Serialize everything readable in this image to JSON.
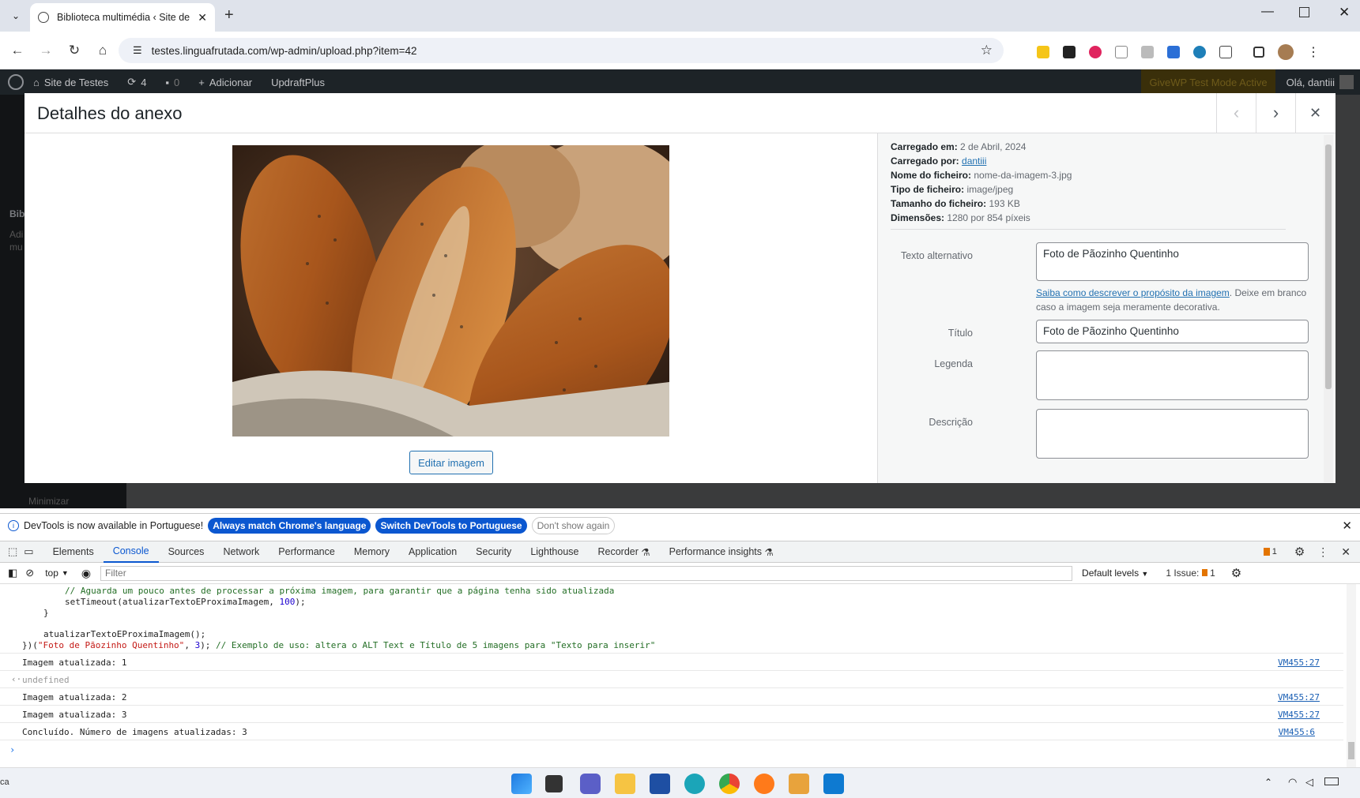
{
  "browser": {
    "tab_title": "Biblioteca multimédia ‹ Site de",
    "url": "testes.linguafrutada.com/wp-admin/upload.php?item=42"
  },
  "wpbar": {
    "site_name": "Site de Testes",
    "updates": "4",
    "comments": "0",
    "add_new": "Adicionar",
    "plugin": "UpdraftPlus",
    "givewp": "GiveWP Test Mode Active",
    "greeting": "Olá, dantiii"
  },
  "sidebar_partial": {
    "title": "Bibl",
    "sub1": "Adi",
    "sub2": "mu",
    "minimize": "Minimizar"
  },
  "modal": {
    "title": "Detalhes do anexo",
    "edit_image": "Editar imagem",
    "info": {
      "uploaded_on_label": "Carregado em:",
      "uploaded_on": "2 de Abril, 2024",
      "uploaded_by_label": "Carregado por:",
      "uploaded_by": "dantiii",
      "filename_label": "Nome do ficheiro:",
      "filename": "nome-da-imagem-3.jpg",
      "filetype_label": "Tipo de ficheiro:",
      "filetype": "image/jpeg",
      "filesize_label": "Tamanho do ficheiro:",
      "filesize": "193 KB",
      "dimensions_label": "Dimensões:",
      "dimensions": "1280 por 854 píxeis"
    },
    "alt_label": "Texto alternativo",
    "alt_value": "Foto de Pãozinho Quentinho",
    "alt_help_link": "Saiba como descrever o propósito da imagem",
    "alt_help_text": ". Deixe em branco caso a imagem seja meramente decorativa.",
    "title_label": "Título",
    "title_value": "Foto de Pãozinho Quentinho",
    "caption_label": "Legenda",
    "description_label": "Descrição"
  },
  "devtools": {
    "info_text": "DevTools is now available in Portuguese!",
    "btn_match": "Always match Chrome's language",
    "btn_switch": "Switch DevTools to Portuguese",
    "btn_dont": "Don't show again",
    "tabs": [
      "Elements",
      "Console",
      "Sources",
      "Network",
      "Performance",
      "Memory",
      "Application",
      "Security",
      "Lighthouse",
      "Recorder",
      "Performance insights"
    ],
    "issues_count": "1",
    "context": "top",
    "filter_placeholder": "Filter",
    "levels": "Default levels",
    "issues_label": "1 Issue:",
    "issues_num": "1",
    "code": {
      "l1": "// Aguarda um pouco antes de processar a próxima imagem, para garantir que a página tenha sido atualizada",
      "l2a": "setTimeout(atualizarTextoEProximaImagem, ",
      "l2n": "100",
      "l2b": ");",
      "l3": "}",
      "l4": "atualizarTextoEProximaImagem();",
      "l5a": "})(",
      "l5s": "\"Foto de Pãozinho Quentinho\"",
      "l5b": ", ",
      "l5n": "3",
      "l5c": "); ",
      "l5cm": "// Exemplo de uso: altera o ALT Text e Título de 5 imagens para \"Texto para inserir\""
    },
    "log": [
      {
        "msg": "Imagem atualizada: 1",
        "src": "VM455:27"
      },
      {
        "msg": "undefined",
        "src": ""
      },
      {
        "msg": "Imagem atualizada: 2",
        "src": "VM455:27"
      },
      {
        "msg": "Imagem atualizada: 3",
        "src": "VM455:27"
      },
      {
        "msg": "Concluído. Número de imagens atualizadas: 3",
        "src": "VM455:6"
      }
    ]
  },
  "taskbar": {
    "left_text": "ca"
  },
  "colors": {
    "wp_blue": "#2271b1",
    "chrome_blue": "#0b57d0"
  }
}
